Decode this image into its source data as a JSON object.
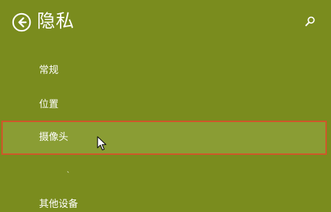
{
  "window": {
    "title": "隐私"
  },
  "header": {
    "back_icon": "back-arrow-icon",
    "search_icon": "search-icon"
  },
  "nav": {
    "items": [
      {
        "label": "常规"
      },
      {
        "label": "位置"
      },
      {
        "label": "摄像头",
        "selected": true
      },
      {
        "label": "、"
      },
      {
        "label": "其他设备"
      }
    ]
  },
  "colors": {
    "background": "#7a8c1e",
    "selected_background": "#8a9d34",
    "selected_border": "#d3542a",
    "text": "#ffffff"
  }
}
